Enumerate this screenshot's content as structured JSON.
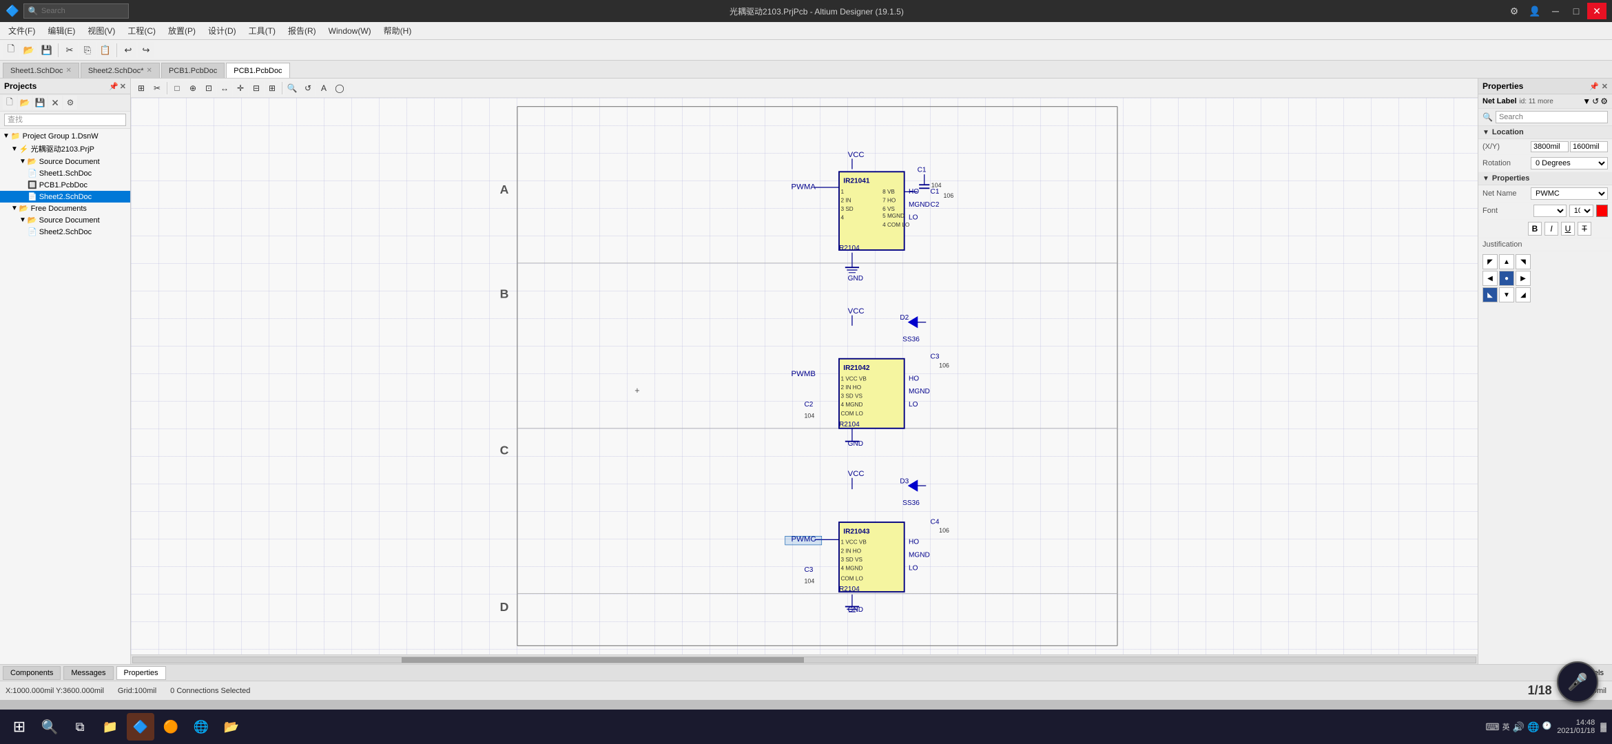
{
  "titlebar": {
    "title": "光耦驱动2103.PrjPcb - Altium Designer (19.1.5)",
    "search_placeholder": "Search",
    "minimize": "─",
    "restore": "□",
    "close": "✕"
  },
  "menubar": {
    "items": [
      "文件(F)",
      "编辑(E)",
      "视图(V)",
      "工程(C)",
      "放置(P)",
      "设计(D)",
      "工具(T)",
      "报告(R)",
      "Window(W)",
      "帮助(H)"
    ]
  },
  "toolbar": {
    "buttons": [
      "🗁",
      "💾",
      "✂",
      "📋",
      "↩",
      "↪"
    ]
  },
  "left_panel": {
    "title": "Projects",
    "search_placeholder": "查找",
    "tree": [
      {
        "label": "Project Group 1.DsnW",
        "level": 0,
        "type": "group",
        "expanded": true
      },
      {
        "label": "光耦驱动2103.PrjP",
        "level": 1,
        "type": "project",
        "expanded": true
      },
      {
        "label": "Source Document",
        "level": 2,
        "type": "folder",
        "expanded": true
      },
      {
        "label": "Sheet1.SchDoc",
        "level": 3,
        "type": "schdoc"
      },
      {
        "label": "PCB1.PcbDoc",
        "level": 3,
        "type": "pcbdoc"
      },
      {
        "label": "Sheet2.SchDoc",
        "level": 3,
        "type": "schdoc",
        "selected": true
      },
      {
        "label": "Free Documents",
        "level": 1,
        "type": "folder",
        "expanded": true
      },
      {
        "label": "Source Document",
        "level": 2,
        "type": "folder",
        "expanded": true
      },
      {
        "label": "Sheet2.SchDoc",
        "level": 3,
        "type": "schdoc"
      }
    ]
  },
  "tabs": [
    {
      "label": "Sheet1.SchDoc",
      "active": false,
      "closable": true
    },
    {
      "label": "Sheet2.SchDoc*",
      "active": false,
      "closable": true
    },
    {
      "label": "PCB1.PcbDoc",
      "active": false,
      "closable": false
    },
    {
      "label": "PCB1.PcbDoc",
      "active": true,
      "closable": false
    }
  ],
  "schematic_toolbar": {
    "buttons": [
      "⊞",
      "✂",
      "□",
      "⊕",
      "⊡",
      "↔",
      "✛",
      "⊟",
      "⊞",
      "◎",
      "↺",
      "A",
      "◯"
    ]
  },
  "row_labels": [
    "B",
    "C",
    "D"
  ],
  "right_panel": {
    "title": "Properties",
    "search_placeholder": "Search",
    "net_label": "Net Label  id: 11 more",
    "location": {
      "header": "Location",
      "xy_label": "(X/Y)",
      "x_value": "3800mil",
      "y_value": "1600mil",
      "rotation_label": "Rotation",
      "rotation_value": "0 Degrees"
    },
    "properties": {
      "header": "Properties",
      "net_name_label": "Net Name",
      "net_name_value": "PWMC",
      "font_label": "Font",
      "font_size": "10",
      "justification_label": "Justification",
      "justification_buttons": [
        "◤",
        "▲",
        "◥",
        "◀",
        "●",
        "▶",
        "◣",
        "▼",
        "◢"
      ]
    }
  },
  "status": {
    "coords": "X:1000.000mil Y:3600.000mil",
    "grid": "Grid:100mil",
    "connections": "0 Connections Selected",
    "page": "1/18",
    "delta": "0mil dY:0mil"
  },
  "bottom_tabs": {
    "items": [
      "Components",
      "Messages",
      "Properties"
    ],
    "right": "Panels"
  },
  "taskbar": {
    "clock": "14:48",
    "date": "2021/01/18"
  }
}
